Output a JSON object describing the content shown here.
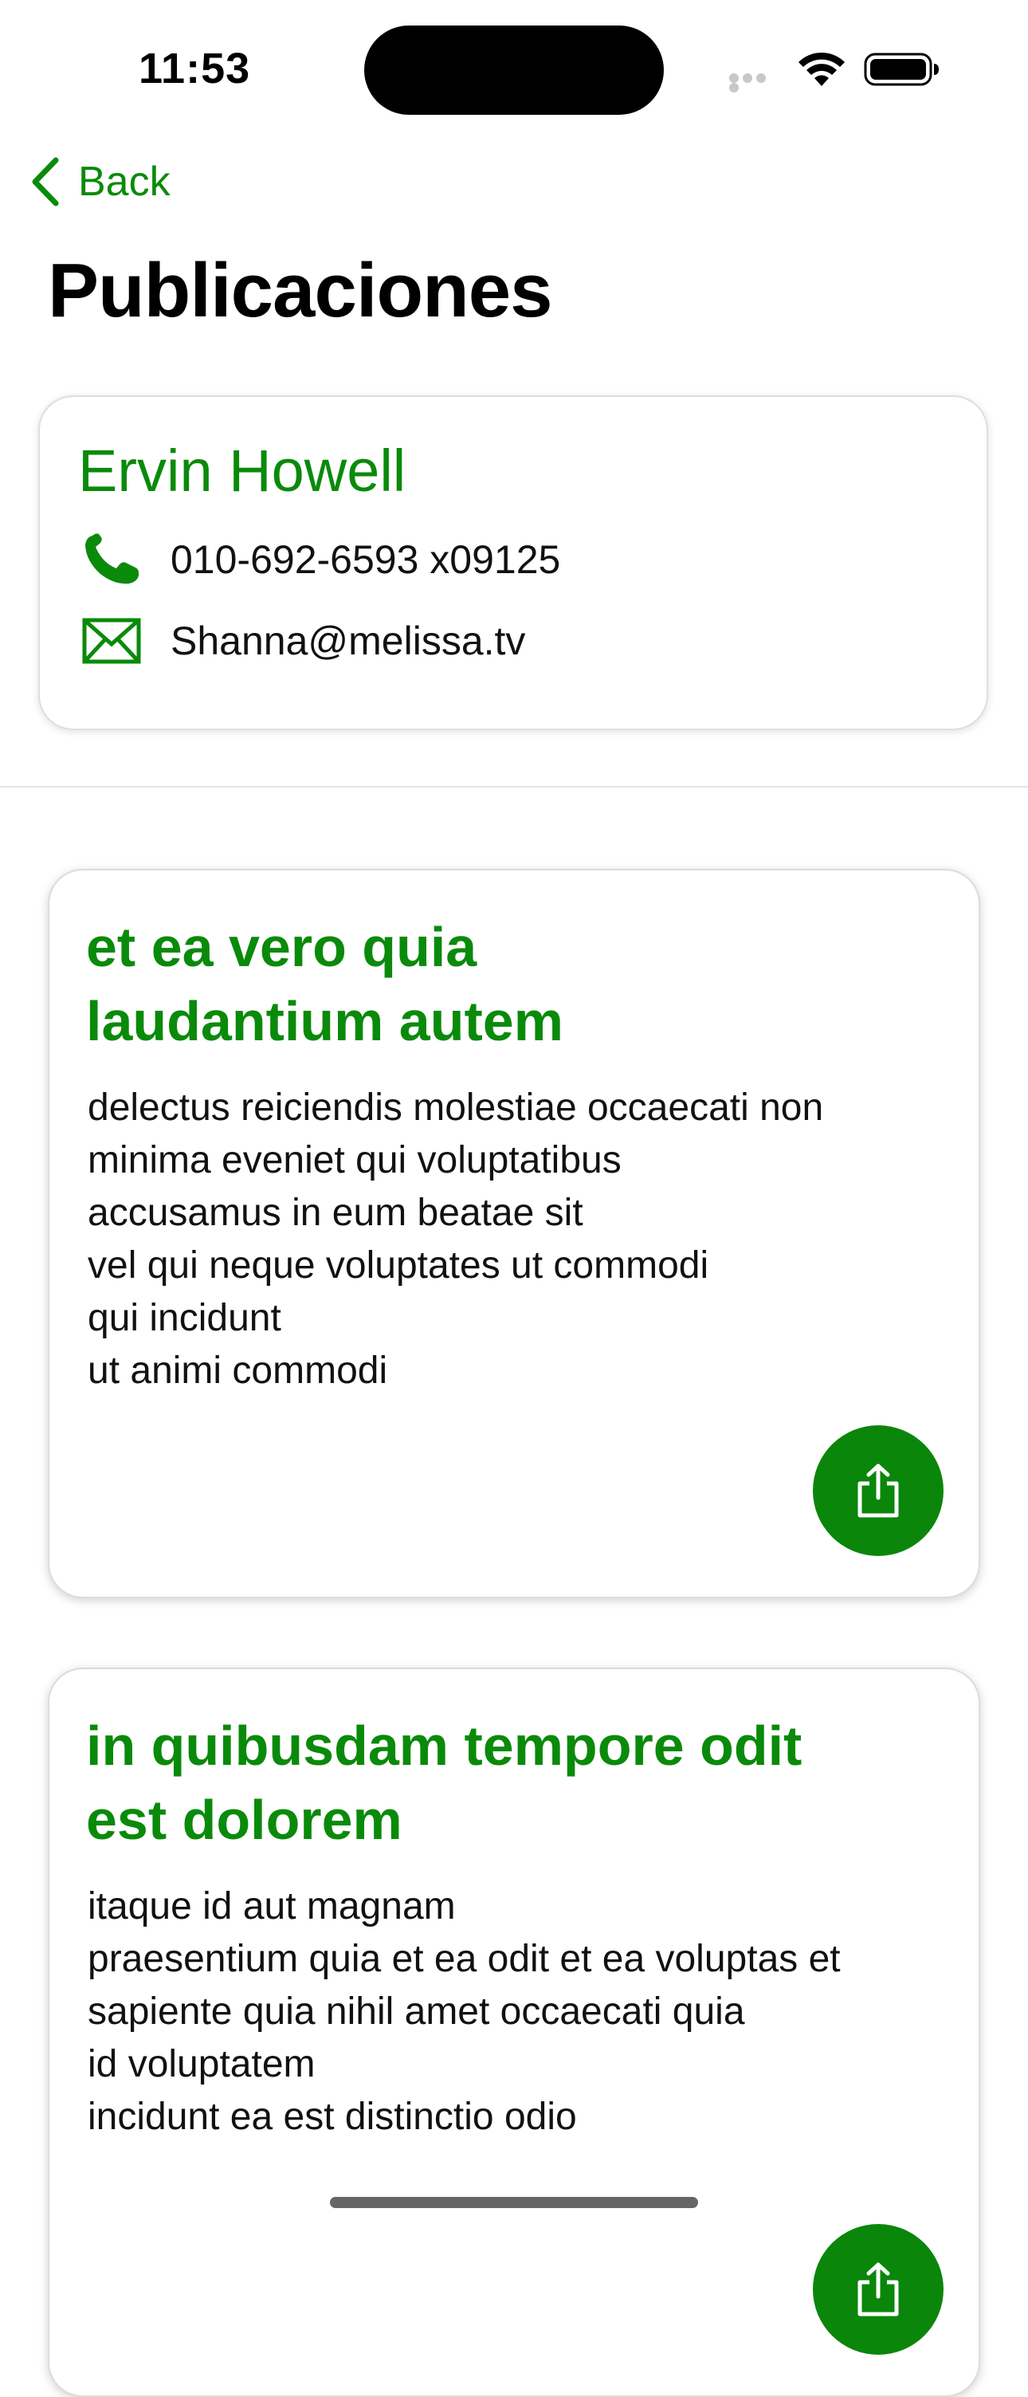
{
  "status_bar": {
    "time": "11:53"
  },
  "nav": {
    "back_label": "Back",
    "title": "Publicaciones"
  },
  "contact": {
    "name": "Ervin Howell",
    "phone": "010-692-6593 x09125",
    "email": "Shanna@melissa.tv"
  },
  "posts": [
    {
      "title": "et ea vero quia\nlaudantium autem",
      "body": "delectus reiciendis molestiae occaecati non\nminima eveniet qui voluptatibus\naccusamus in eum beatae sit\nvel qui neque voluptates ut commodi\nqui incidunt\nut animi commodi",
      "share_icon": "share-icon"
    },
    {
      "title": "in quibusdam tempore odit\nest dolorem",
      "body": "itaque id aut magnam\npraesentium quia et ea odit et ea voluptas et\nsapiente quia nihil amet occaecati quia\nid voluptatem\nincidunt ea est distinctio odio",
      "share_icon": "share-icon"
    }
  ],
  "colors": {
    "accent": "#0a8a0a",
    "text": "#111111",
    "background": "#ffffff"
  },
  "icons": {
    "back": "chevron-left-icon",
    "phone": "phone-icon",
    "email": "envelope-icon",
    "share": "share-icon",
    "wifi": "wifi-icon",
    "battery": "battery-icon"
  }
}
